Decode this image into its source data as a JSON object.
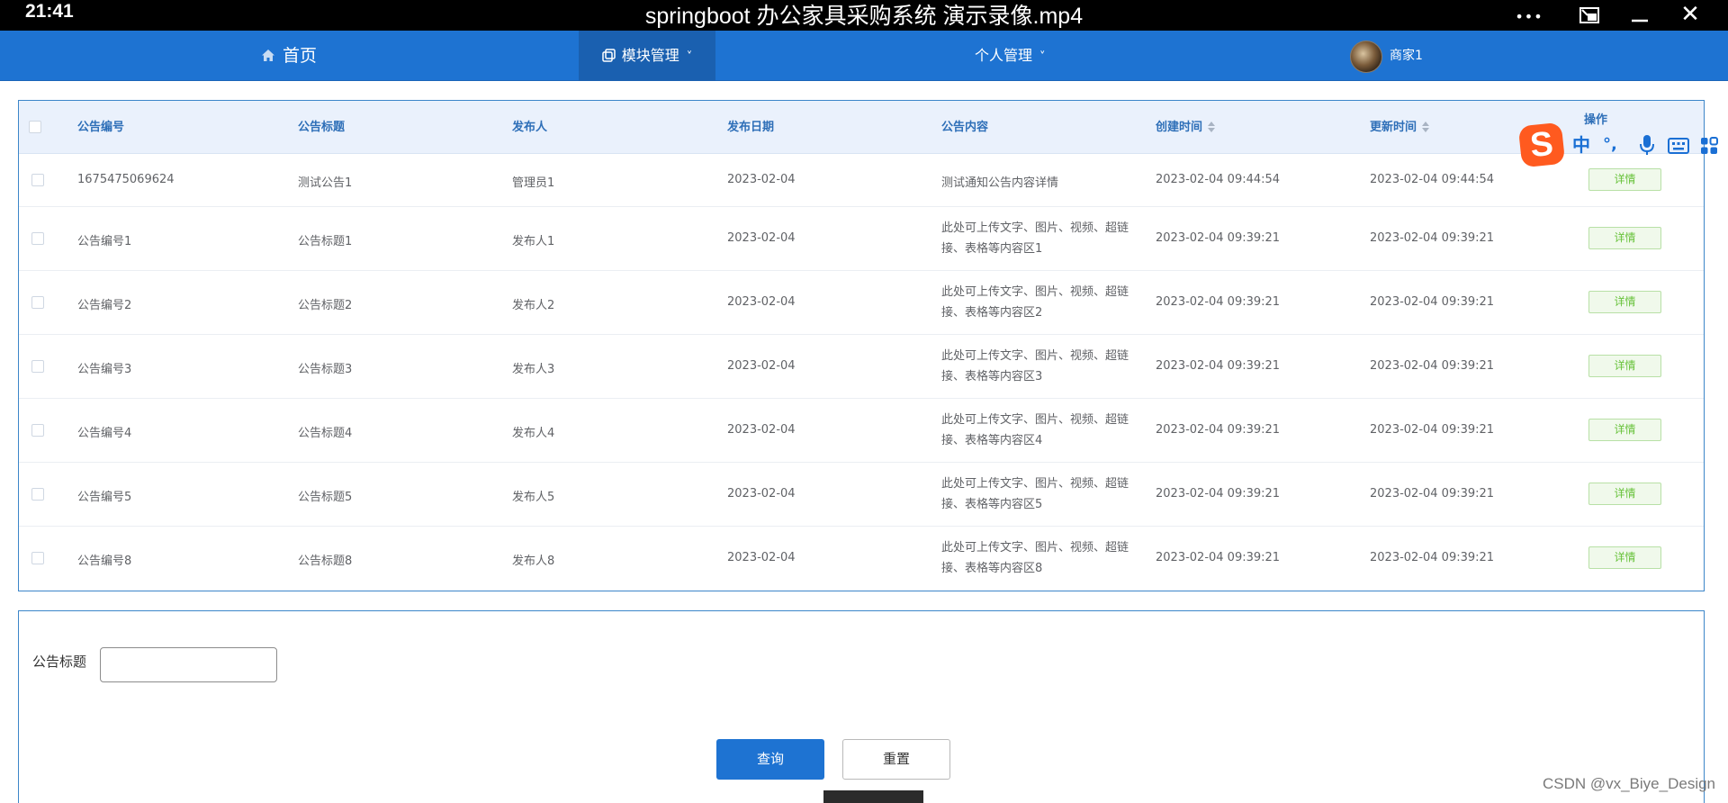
{
  "player": {
    "time": "21:41",
    "title": "springboot 办公家具采购系统 演示录像.mp4",
    "controls": [
      "more-icon",
      "restore-icon",
      "minimize-icon",
      "close-icon"
    ],
    "more_glyph": "•••",
    "close_glyph": "✕"
  },
  "nav": {
    "home": "首页",
    "module": "模块管理",
    "personal": "个人管理",
    "user": "商家1",
    "caret": "˅"
  },
  "table": {
    "headers": {
      "no": "公告编号",
      "title": "公告标题",
      "publisher": "发布人",
      "date": "发布日期",
      "content": "公告内容",
      "created": "创建时间",
      "updated": "更新时间",
      "action": "操作"
    },
    "detail_label": "详情",
    "rows": [
      {
        "no": "1675475069624",
        "title": "测试公告1",
        "publisher": "管理员1",
        "date": "2023-02-04",
        "content": "测试通知公告内容详情",
        "created": "2023-02-04 09:44:54",
        "updated": "2023-02-04 09:44:54"
      },
      {
        "no": "公告编号1",
        "title": "公告标题1",
        "publisher": "发布人1",
        "date": "2023-02-04",
        "content": "此处可上传文字、图片、视频、超链接、表格等内容区1",
        "created": "2023-02-04 09:39:21",
        "updated": "2023-02-04 09:39:21"
      },
      {
        "no": "公告编号2",
        "title": "公告标题2",
        "publisher": "发布人2",
        "date": "2023-02-04",
        "content": "此处可上传文字、图片、视频、超链接、表格等内容区2",
        "created": "2023-02-04 09:39:21",
        "updated": "2023-02-04 09:39:21"
      },
      {
        "no": "公告编号3",
        "title": "公告标题3",
        "publisher": "发布人3",
        "date": "2023-02-04",
        "content": "此处可上传文字、图片、视频、超链接、表格等内容区3",
        "created": "2023-02-04 09:39:21",
        "updated": "2023-02-04 09:39:21"
      },
      {
        "no": "公告编号4",
        "title": "公告标题4",
        "publisher": "发布人4",
        "date": "2023-02-04",
        "content": "此处可上传文字、图片、视频、超链接、表格等内容区4",
        "created": "2023-02-04 09:39:21",
        "updated": "2023-02-04 09:39:21"
      },
      {
        "no": "公告编号5",
        "title": "公告标题5",
        "publisher": "发布人5",
        "date": "2023-02-04",
        "content": "此处可上传文字、图片、视频、超链接、表格等内容区5",
        "created": "2023-02-04 09:39:21",
        "updated": "2023-02-04 09:39:21"
      },
      {
        "no": "公告编号8",
        "title": "公告标题8",
        "publisher": "发布人8",
        "date": "2023-02-04",
        "content": "此处可上传文字、图片、视频、超链接、表格等内容区8",
        "created": "2023-02-04 09:39:21",
        "updated": "2023-02-04 09:39:21"
      }
    ]
  },
  "search": {
    "label": "公告标题",
    "value": "",
    "query_button": "查询",
    "reset_button": "重置"
  },
  "ime": {
    "logo": "S",
    "chinese": "中",
    "punct": "°,",
    "icons": [
      "ime-logo-icon",
      "microphone-icon",
      "keyboard-icon",
      "grid-icon"
    ]
  },
  "watermark": "CSDN @vx_Biye_Design",
  "colors": {
    "nav_bg": "#1e73d2",
    "nav_active": "#1a60b0",
    "header_text": "#2e6fb8",
    "detail_green": "#67c23a",
    "query_btn": "#1e73d2"
  }
}
